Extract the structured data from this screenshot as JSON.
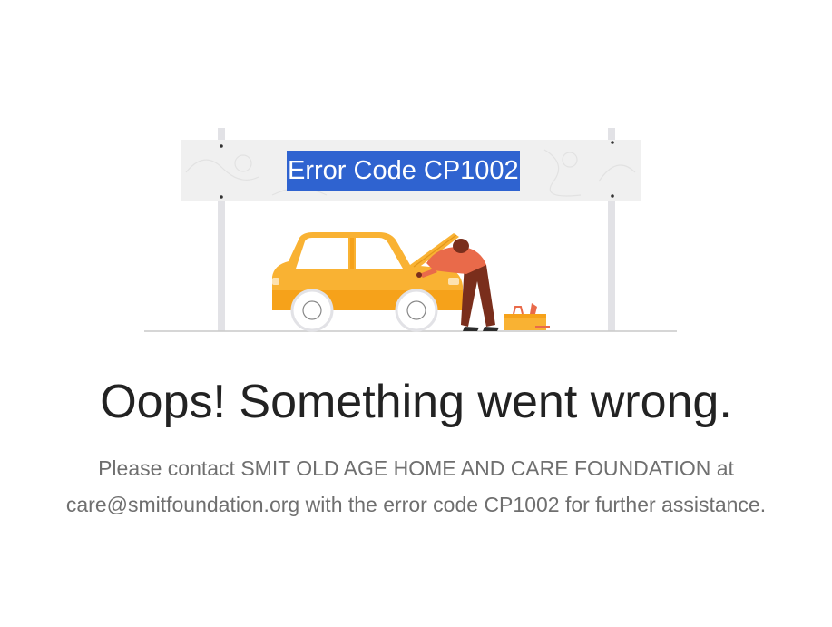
{
  "illustration": {
    "sign_text": "Error Code CP1002",
    "icon": "mechanic-repairing-car-illustration",
    "colors": {
      "car_body": "#f9b233",
      "car_lower": "#f6a21a",
      "worker_shirt": "#e96a4a",
      "worker_pants": "#7a2e1c",
      "sign_board": "#f0f0f0",
      "pole": "#e2e2e6",
      "highlight": "#2f63d0"
    }
  },
  "error": {
    "title": "Oops! Something went wrong.",
    "message": "Please contact SMIT OLD AGE HOME AND CARE FOUNDATION at care@smitfoundation.org with the error code CP1002 for further assistance."
  }
}
